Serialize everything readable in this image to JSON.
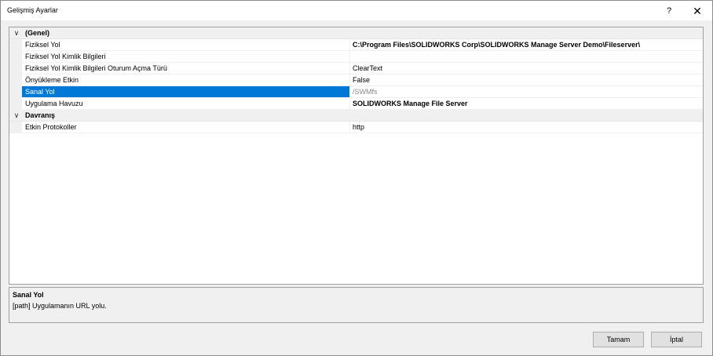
{
  "window": {
    "title": "Gelişmiş Ayarlar",
    "help_label": "?",
    "close_label": "✕"
  },
  "grid": {
    "categories": [
      {
        "name": "(Genel)",
        "expander": "∨",
        "properties": [
          {
            "name": "Fiziksel Yol",
            "value": "C:\\Program Files\\SOLIDWORKS Corp\\SOLIDWORKS Manage Server Demo\\Fileserver\\"
          },
          {
            "name": "Fiziksel Yol Kimlik Bilgileri",
            "value": ""
          },
          {
            "name": "Fiziksel Yol Kimlik Bilgileri Oturum Açma Türü",
            "value": "ClearText"
          },
          {
            "name": "Önyükleme Etkin",
            "value": "False"
          },
          {
            "name": "Sanal Yol",
            "value": "/SWMfs"
          },
          {
            "name": "Uygulama Havuzu",
            "value": "SOLIDWORKS Manage File Server"
          }
        ]
      },
      {
        "name": "Davranış",
        "expander": "∨",
        "properties": [
          {
            "name": "Etkin Protokoller",
            "value": "http"
          }
        ]
      }
    ]
  },
  "description": {
    "title": "Sanal Yol",
    "text": "[path] Uygulamanın URL yolu."
  },
  "buttons": {
    "ok": "Tamam",
    "cancel": "İptal"
  }
}
